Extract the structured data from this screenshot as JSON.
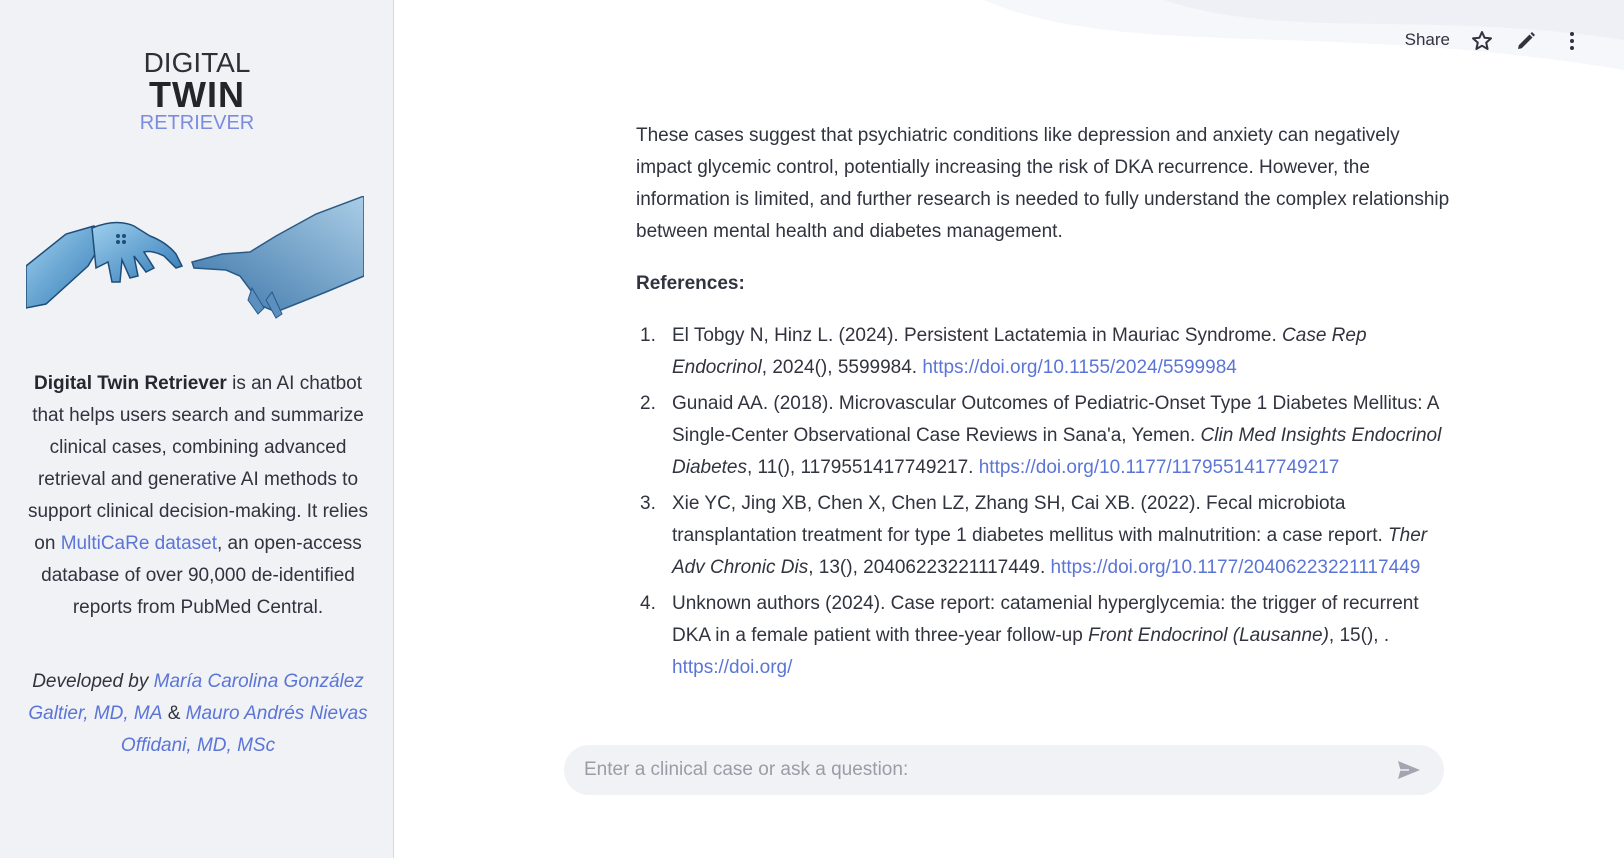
{
  "sidebar": {
    "logo": {
      "line1": "DIGITAL",
      "line2": "TWIN",
      "line3": "RETRIEVER"
    },
    "description": {
      "app_name": "Digital Twin Retriever",
      "text1": " is an AI chatbot that helps users search and summarize clinical cases, combining advanced retrieval and generative AI methods to support clinical decision-making. It relies on ",
      "link": "MultiCaRe dataset",
      "text2": ", an open-access database of over 90,000 de-identified reports from PubMed Central."
    },
    "credits": {
      "prefix": "Developed by ",
      "author1": "María Carolina González Galtier, MD, MA",
      "joiner": " & ",
      "author2": "Mauro Andrés Nievas Offidani, MD, MSc"
    }
  },
  "toolbar": {
    "share_label": "Share",
    "icons": [
      "star-icon",
      "pencil-icon",
      "more-vertical-icon"
    ]
  },
  "main": {
    "summary": "These cases suggest that psychiatric conditions like depression and anxiety can negatively impact glycemic control, potentially increasing the risk of DKA recurrence. However, the information is limited, and further research is needed to fully understand the complex relationship between mental health and diabetes management.",
    "references_heading": "References:",
    "references": [
      {
        "num": "1.",
        "text": "El Tobgy N, Hinz L. (2024). Persistent Lactatemia in Mauriac Syndrome. ",
        "journal": "Case Rep Endocrinol",
        "details": ", 2024(), 5599984. ",
        "doi": "https://doi.org/10.1155/2024/5599984"
      },
      {
        "num": "2.",
        "text": "Gunaid AA. (2018). Microvascular Outcomes of Pediatric-Onset Type 1 Diabetes Mellitus: A Single-Center Observational Case Reviews in Sana'a, Yemen. ",
        "journal": "Clin Med Insights Endocrinol Diabetes",
        "details": ", 11(), 1179551417749217. ",
        "doi": "https://doi.org/10.1177/1179551417749217"
      },
      {
        "num": "3.",
        "text": "Xie YC, Jing XB, Chen X, Chen LZ, Zhang SH, Cai XB. (2022). Fecal microbiota transplantation treatment for type 1 diabetes mellitus with malnutrition: a case report. ",
        "journal": "Ther Adv Chronic Dis",
        "details": ", 13(), 20406223221117449. ",
        "doi": "https://doi.org/10.1177/20406223221117449"
      },
      {
        "num": "4.",
        "text": "Unknown authors (2024). Case report: catamenial hyperglycemia: the trigger of recurrent DKA in a female patient with three-year follow-up ",
        "journal": "Front Endocrinol (Lausanne)",
        "details": ", 15(), . ",
        "doi": "https://doi.org/"
      }
    ]
  },
  "chat": {
    "placeholder": "Enter a clinical case or ask a question:",
    "value": ""
  },
  "colors": {
    "link": "#5b75d6",
    "sidebar_bg": "#f0f2f6",
    "logo_accent": "#7b8be0"
  }
}
